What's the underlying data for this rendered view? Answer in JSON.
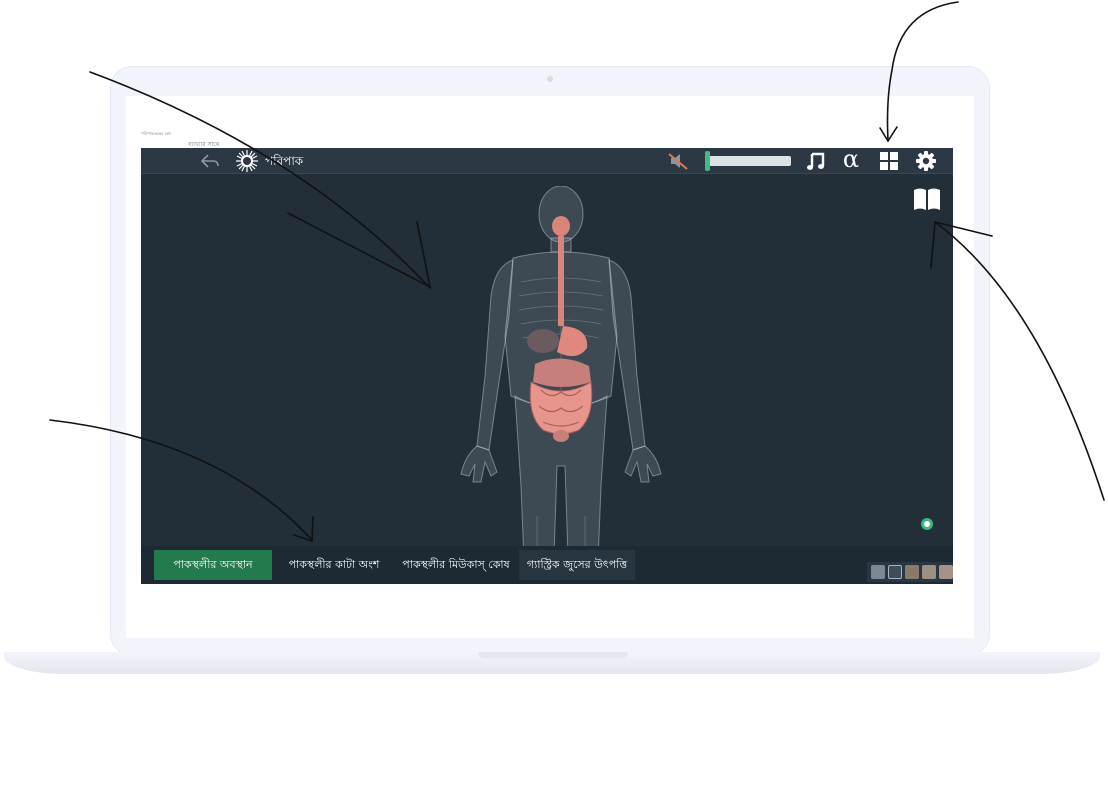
{
  "header": {
    "mini_line1": "পরিপাকতন্ত্রের অঙ্গ",
    "mini_line2": "ব্যাখ্যার সাথে"
  },
  "app": {
    "title": "পরিপাক",
    "icons": {
      "back": "back-arrow-icon",
      "logo": "sun-logo-icon",
      "mute": "mute-speaker-icon",
      "music": "music-note-icon",
      "alpha": "α",
      "grid": "grid-menu-icon",
      "gear": "gear-icon",
      "book": "open-book-icon"
    },
    "volume_level": 0.0,
    "accent_color": "#237a4d",
    "background_color": "#222e38"
  },
  "tabs": [
    {
      "label": "পাকস্থলীর অবস্থান",
      "active": true
    },
    {
      "label": "পাকস্থলীর কাটা অংশ",
      "active": false
    },
    {
      "label": "পাকস্থলীর  মিউকাস্ কোষ",
      "active": false
    },
    {
      "label": "গ্যাস্ট্রিক জুসের উৎপত্তি",
      "active": false
    }
  ]
}
